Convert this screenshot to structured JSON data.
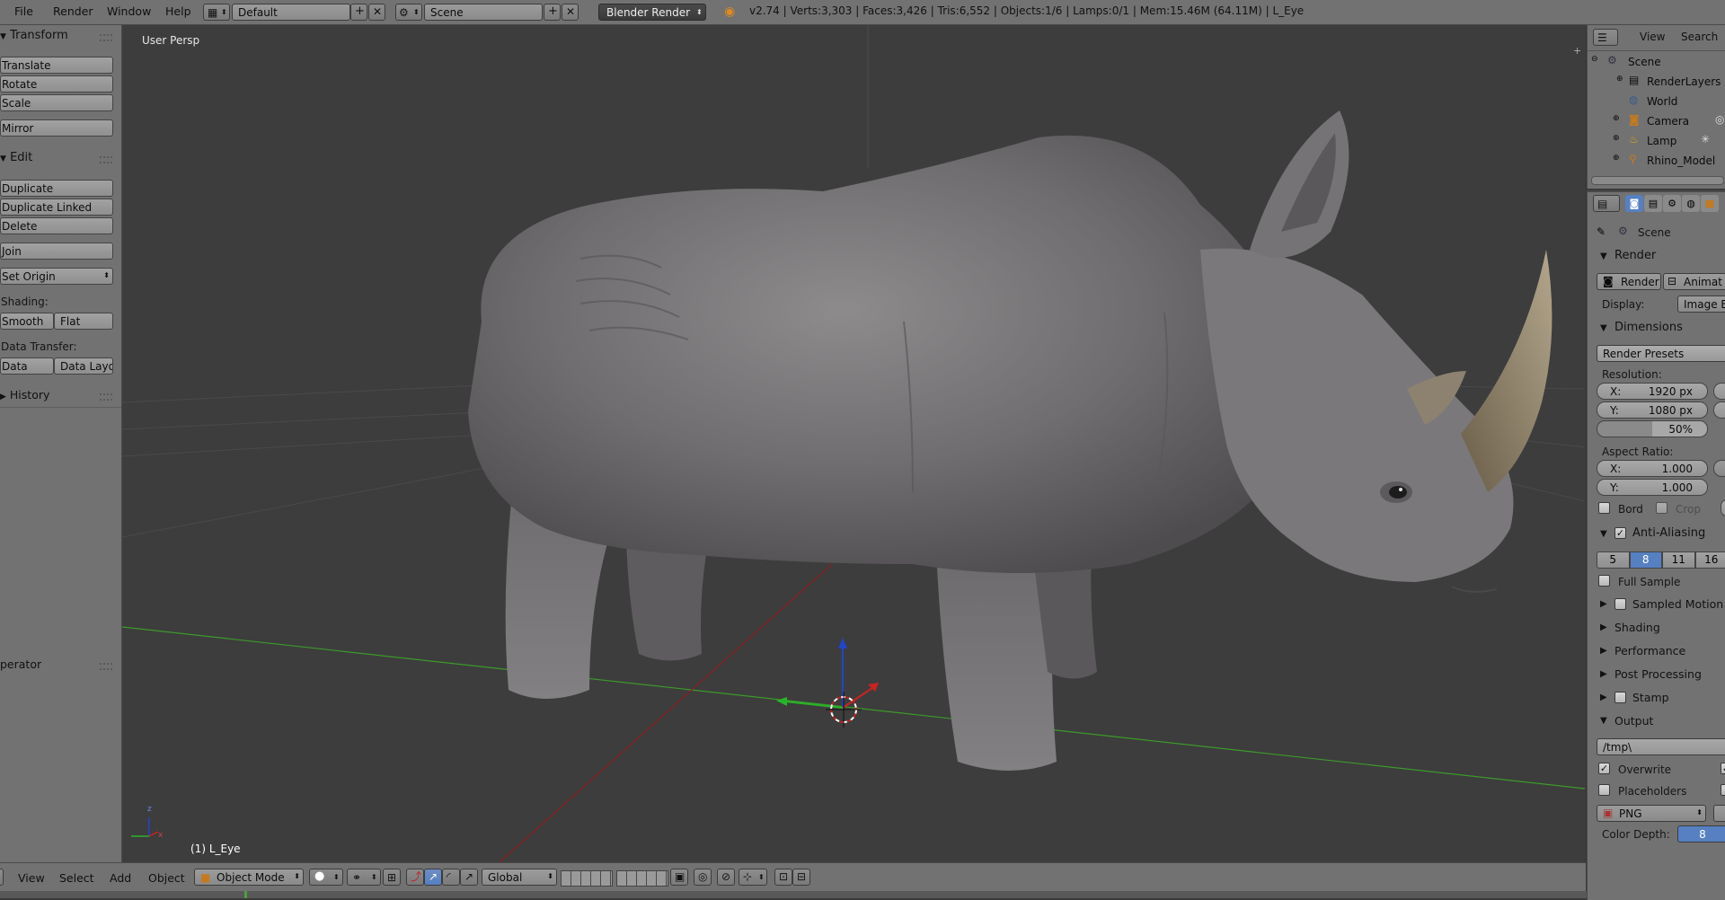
{
  "topbar": {
    "menus": [
      "File",
      "Render",
      "Window",
      "Help"
    ],
    "screen_layout": "Default",
    "scene": "Scene",
    "render_engine": "Blender Render",
    "stats": "v2.74 | Verts:3,303 | Faces:3,426 | Tris:6,552 | Objects:1/6 | Lamps:0/1 | Mem:15.46M (64.11M) | L_Eye"
  },
  "toolshelf": {
    "transform_header": "Transform",
    "transform_buttons": [
      "Translate",
      "Rotate",
      "Scale",
      "Mirror"
    ],
    "edit_header": "Edit",
    "edit_buttons": [
      "Duplicate",
      "Duplicate Linked",
      "Delete",
      "Join"
    ],
    "set_origin": "Set Origin",
    "shading_label": "Shading:",
    "shading_buttons": [
      "Smooth",
      "Flat"
    ],
    "data_transfer_label": "Data Transfer:",
    "data_transfer_buttons": [
      "Data",
      "Data Layo"
    ],
    "history_header": "History",
    "operator_header": "perator"
  },
  "viewport": {
    "view_name": "User Persp",
    "active_object": "(1) L_Eye",
    "axis_x": "x",
    "axis_z": "z"
  },
  "bottombar": {
    "menus": [
      "View",
      "Select",
      "Add",
      "Object"
    ],
    "mode": "Object Mode",
    "orientation": "Global"
  },
  "outliner": {
    "menus": [
      "View",
      "Search"
    ],
    "items": [
      {
        "name": "Scene",
        "icon": "scene-icon"
      },
      {
        "name": "RenderLayers",
        "icon": "render-layers-icon"
      },
      {
        "name": "World",
        "icon": "world-icon"
      },
      {
        "name": "Camera",
        "icon": "camera-icon"
      },
      {
        "name": "Lamp",
        "icon": "lamp-icon"
      },
      {
        "name": "Rhino_Model",
        "icon": "armature-icon"
      }
    ]
  },
  "properties": {
    "context": "Scene",
    "render_header": "Render",
    "render_button": "Render",
    "animation_button": "Animat",
    "display_label": "Display:",
    "display_value": "Image E",
    "dimensions_header": "Dimensions",
    "render_presets": "Render Presets",
    "resolution_label": "Resolution:",
    "res_x_label": "X:",
    "res_x": "1920 px",
    "res_y_label": "Y:",
    "res_y": "1080 px",
    "res_percent": "50%",
    "aspect_label": "Aspect Ratio:",
    "aspect_x_label": "X:",
    "aspect_x": "1.000",
    "aspect_y_label": "Y:",
    "aspect_y": "1.000",
    "border_label": "Bord",
    "crop_label": "Crop",
    "aa_header": "Anti-Aliasing",
    "aa_samples": [
      "5",
      "8",
      "11",
      "16"
    ],
    "aa_selected": "8",
    "full_sample": "Full Sample",
    "sampled_motion": "Sampled Motion B",
    "shading": "Shading",
    "performance": "Performance",
    "post_processing": "Post Processing",
    "stamp": "Stamp",
    "output_header": "Output",
    "output_path": "/tmp\\",
    "overwrite": "Overwrite",
    "placeholders": "Placeholders",
    "file_format": "PNG",
    "color_depth_label": "Color Depth:",
    "color_depth": "8"
  },
  "colors": {
    "panel_bg": "#727272",
    "viewport_bg": "#3d3d3d",
    "selected_blue": "#5680c2",
    "axis_green": "#3c9a2a",
    "axis_red": "#a12020"
  }
}
